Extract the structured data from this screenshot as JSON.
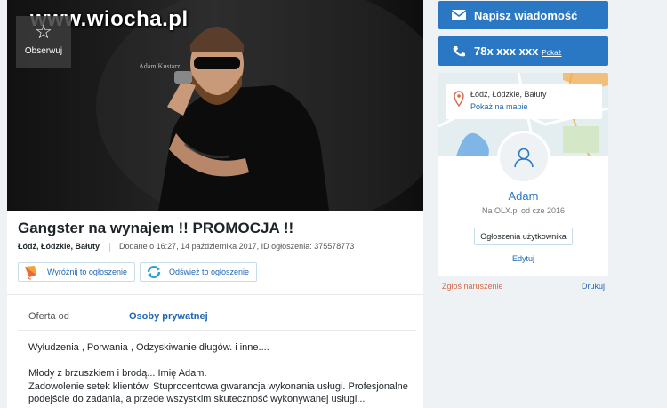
{
  "watermark": "www.wiocha.pl",
  "observe": {
    "label": "Obserwuj"
  },
  "photo": {
    "signature": "Adam Kustarz"
  },
  "ad": {
    "title": "Gangster na wynajem !! PROMOCJA !!",
    "location": "Łódź, Łódzkie, Bałuty",
    "date_info": "Dodane o 16:27, 14 października 2017, ID ogłoszenia: 375578773",
    "promote_label": "Wyróżnij to ogłoszenie",
    "refresh_label": "Odśwież to ogłoszenie",
    "offer_label": "Oferta od",
    "offer_value": "Osoby prywatnej",
    "description": [
      "Wyłudzenia , Porwania , Odzyskiwanie długów. i inne....",
      "",
      "Młody z brzuszkiem i brodą... Imię Adam.",
      "Zadowolenie setek klientów. Stuprocentowa gwarancja wykonania usługi. Profesjonalne",
      "podejście do zadania, a przede wszystkim skuteczność wykonywanej usługi..."
    ]
  },
  "sidebar": {
    "message_button": "Napisz wiadomość",
    "phone_number": "78x xxx xxx",
    "phone_show": "Pokaż",
    "map_location": "Łódź, Łódzkie, Bałuty",
    "map_link": "Pokaż na mapie",
    "user_name": "Adam",
    "member_since": "Na OLX.pl od cze 2016",
    "user_ads_button": "Ogłoszenia użytkownika",
    "edit_link": "Edytuj",
    "report_link": "Zgłoś naruszenie",
    "print_link": "Drukuj"
  },
  "colors": {
    "accent": "#2a78c4",
    "link": "#1f65b3",
    "report": "#d46b4b",
    "background": "#eef2f4"
  }
}
